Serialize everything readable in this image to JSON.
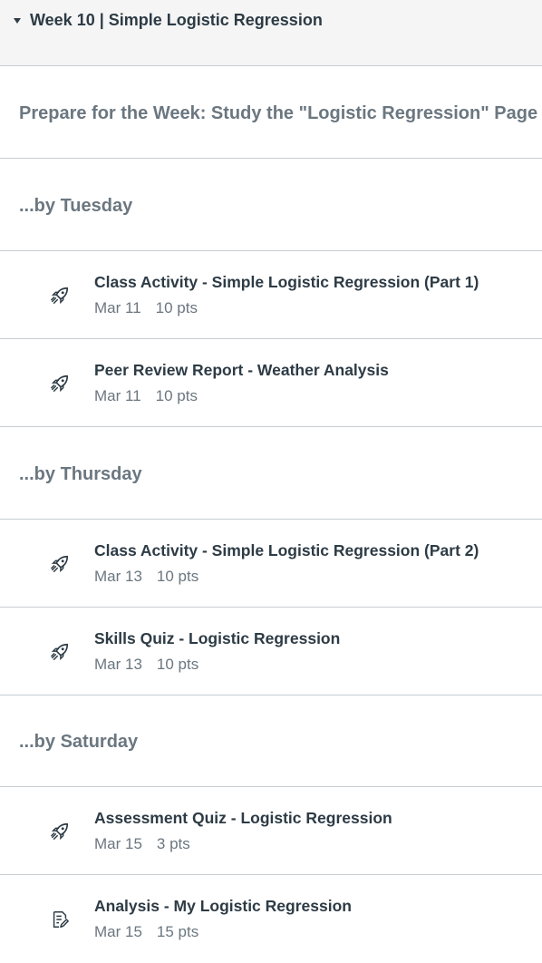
{
  "module": {
    "title": "Week 10 | Simple Logistic Regression"
  },
  "prepare": {
    "label": "Prepare for the Week: Study the \"Logistic Regression\" Page"
  },
  "groups": [
    {
      "label": "...by Tuesday",
      "items": [
        {
          "title": "Class Activity - Simple Logistic Regression (Part 1)",
          "date": "Mar 11",
          "points": "10 pts",
          "icon": "rocket-icon"
        },
        {
          "title": "Peer Review Report - Weather Analysis",
          "date": "Mar 11",
          "points": "10 pts",
          "icon": "rocket-icon"
        }
      ]
    },
    {
      "label": "...by Thursday",
      "items": [
        {
          "title": "Class Activity - Simple Logistic Regression (Part 2)",
          "date": "Mar 13",
          "points": "10 pts",
          "icon": "rocket-icon"
        },
        {
          "title": "Skills Quiz - Logistic Regression",
          "date": "Mar 13",
          "points": "10 pts",
          "icon": "rocket-icon"
        }
      ]
    },
    {
      "label": "...by Saturday",
      "items": [
        {
          "title": "Assessment Quiz - Logistic Regression",
          "date": "Mar 15",
          "points": "3 pts",
          "icon": "rocket-icon"
        },
        {
          "title": "Analysis - My Logistic Regression",
          "date": "Mar 15",
          "points": "15 pts",
          "icon": "assignment-edit-icon"
        }
      ]
    }
  ],
  "colors": {
    "header_bg": "#f5f5f5",
    "border": "#c7cdd1",
    "text_primary": "#2d3b45",
    "text_secondary": "#6b7780"
  }
}
